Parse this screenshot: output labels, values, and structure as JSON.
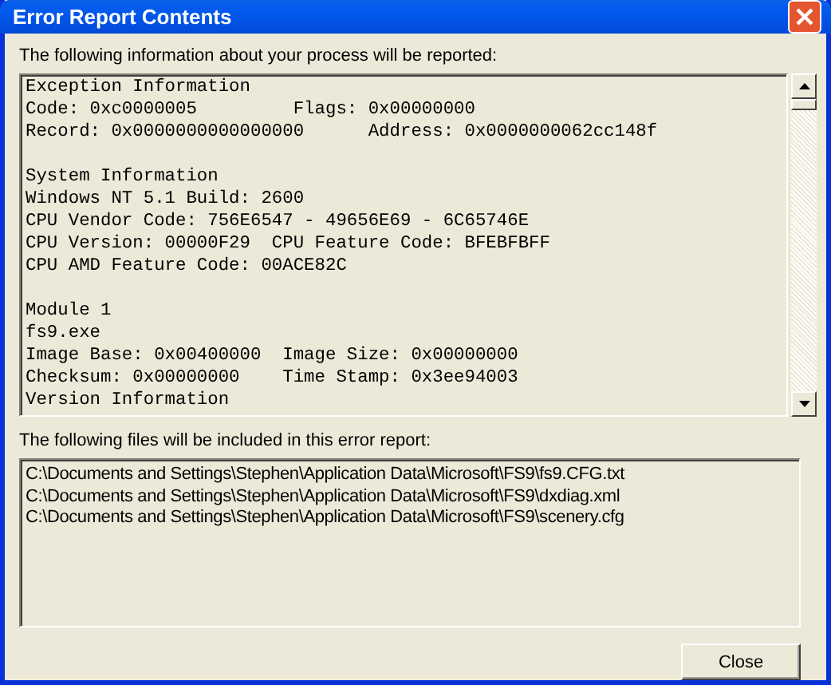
{
  "window": {
    "title": "Error Report Contents"
  },
  "report": {
    "label": "The following information about your process will be reported:",
    "sections": [
      {
        "lines": [
          "Exception Information",
          "Code: 0xc0000005         Flags: 0x00000000",
          "Record: 0x0000000000000000      Address: 0x0000000062cc148f"
        ]
      },
      {
        "lines": [
          "System Information",
          "Windows NT 5.1 Build: 2600",
          "CPU Vendor Code: 756E6547 - 49656E69 - 6C65746E",
          "CPU Version: 00000F29  CPU Feature Code: BFEBFBFF",
          "CPU AMD Feature Code: 00ACE82C"
        ]
      },
      {
        "lines": [
          "Module 1",
          "fs9.exe",
          "Image Base: 0x00400000  Image Size: 0x00000000",
          "Checksum: 0x00000000    Time Stamp: 0x3ee94003",
          "Version Information"
        ]
      }
    ]
  },
  "files": {
    "label": "The following files will be included in this error report:",
    "items": [
      "C:\\Documents and Settings\\Stephen\\Application Data\\Microsoft\\FS9\\fs9.CFG.txt",
      "C:\\Documents and Settings\\Stephen\\Application Data\\Microsoft\\FS9\\dxdiag.xml",
      "C:\\Documents and Settings\\Stephen\\Application Data\\Microsoft\\FS9\\scenery.cfg"
    ]
  },
  "buttons": [
    "Close"
  ]
}
